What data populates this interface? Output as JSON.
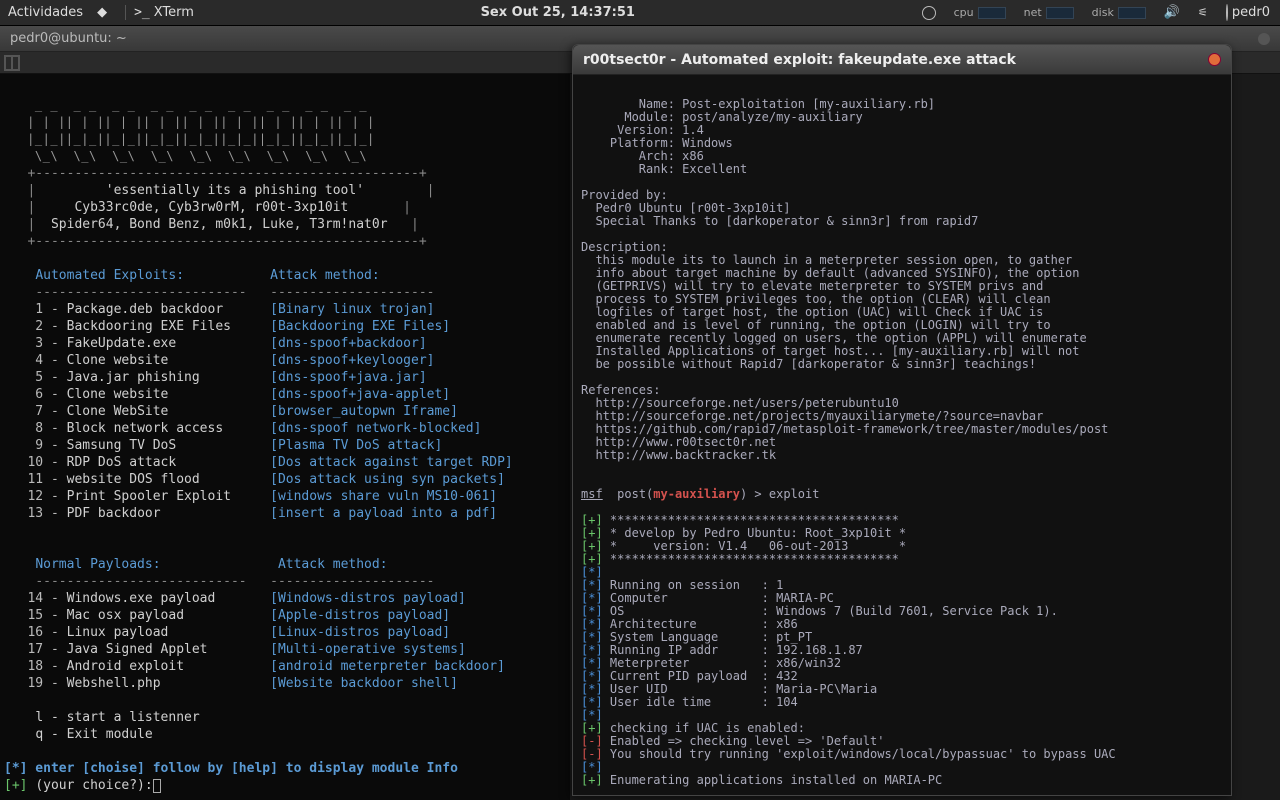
{
  "topbar": {
    "activities": "Actividades",
    "xterm": "XTerm",
    "datetime": "Sex Out 25, 14:37:51",
    "cpu": "cpu",
    "net": "net",
    "disk": "disk",
    "user": "pedr0"
  },
  "window": {
    "title": "pedr0@ubuntu: ~"
  },
  "terminal": {
    "banner_tag": "'essentially its a phishing tool'",
    "credits1": "Cyb33rc0de, Cyb3rw0rM, r00t-3xp10it",
    "credits2": "Spider64, Bond Benz, m0k1, Luke, T3rm!nat0r",
    "header_exploits": "Automated Exploits:",
    "header_method": "Attack method:",
    "exploits": [
      {
        "n": " 1",
        "name": "Package.deb backdoor",
        "method": "[Binary linux trojan]"
      },
      {
        "n": " 2",
        "name": "Backdooring EXE Files",
        "method": "[Backdooring EXE Files]"
      },
      {
        "n": " 3",
        "name": "FakeUpdate.exe",
        "method": "[dns-spoof+backdoor]"
      },
      {
        "n": " 4",
        "name": "Clone website",
        "method": "[dns-spoof+keylooger]"
      },
      {
        "n": " 5",
        "name": "Java.jar phishing",
        "method": "[dns-spoof+java.jar]"
      },
      {
        "n": " 6",
        "name": "Clone website",
        "method": "[dns-spoof+java-applet]"
      },
      {
        "n": " 7",
        "name": "Clone WebSite",
        "method": "[browser_autopwn Iframe]"
      },
      {
        "n": " 8",
        "name": "Block network access",
        "method": "[dns-spoof network-blocked]"
      },
      {
        "n": " 9",
        "name": "Samsung TV DoS",
        "method": "[Plasma TV DoS attack]"
      },
      {
        "n": "10",
        "name": "RDP DoS attack",
        "method": "[Dos attack against target RDP]"
      },
      {
        "n": "11",
        "name": "website DOS flood",
        "method": "[Dos attack using syn packets]"
      },
      {
        "n": "12",
        "name": "Print Spooler Exploit",
        "method": "[windows share vuln MS10-061]"
      },
      {
        "n": "13",
        "name": "PDF backdoor",
        "method": "[insert a payload into a pdf]"
      }
    ],
    "header_payloads": "Normal Payloads:",
    "payloads": [
      {
        "n": "14",
        "name": "Windows.exe payload",
        "method": "[Windows-distros payload]"
      },
      {
        "n": "15",
        "name": "Mac osx payload",
        "method": "[Apple-distros payload]"
      },
      {
        "n": "16",
        "name": "Linux payload",
        "method": "[Linux-distros payload]"
      },
      {
        "n": "17",
        "name": "Java Signed Applet",
        "method": "[Multi-operative systems]"
      },
      {
        "n": "18",
        "name": "Android exploit",
        "method": "[android meterpreter backdoor]"
      },
      {
        "n": "19",
        "name": "Webshell.php",
        "method": "[Website backdoor shell]"
      }
    ],
    "opt_l": "l - start a listenner",
    "opt_q": "q - Exit module",
    "hint": "[*] enter [choise] follow by [help] to display module Info",
    "prompt_prefix": "[+] ",
    "prompt": "(your choice?):"
  },
  "popup": {
    "title": "r00tsect0r - Automated exploit: fakeupdate.exe attack",
    "info": {
      "Name": "Post-exploitation [my-auxiliary.rb]",
      "Module": "post/analyze/my-auxiliary",
      "Version": "1.4",
      "Platform": "Windows",
      "Arch": "x86",
      "Rank": "Excellent"
    },
    "provided_head": "Provided by:",
    "provided": [
      "Pedr0 Ubuntu [r00t-3xp10it]",
      "Special Thanks to [darkoperator & sinn3r] from rapid7"
    ],
    "desc_head": "Description:",
    "desc": [
      "this module its to launch in a meterpreter session open, to gather",
      "info about target machine by default (advanced SYSINFO), the option",
      "(GETPRIVS) will try to elevate meterpreter to SYSTEM privs and",
      "process to SYSTEM privileges too, the option (CLEAR) will clean",
      "logfiles of target host, the option (UAC) will Check if UAC is",
      "enabled and is level of running, the option (LOGIN) will try to",
      "enumerate recently logged on users, the option (APPL) will enumerate",
      "Installed Applications of target host... [my-auxiliary.rb] will not",
      "be possible without Rapid7 [darkoperator & sinn3r] teachings!"
    ],
    "refs_head": "References:",
    "refs": [
      "http://sourceforge.net/users/peterubuntu10",
      "http://sourceforge.net/projects/myauxiliarymete/?source=navbar",
      "https://github.com/rapid7/metasploit-framework/tree/master/modules/post",
      "http://www.r00tsect0r.net",
      "http://www.backtracker.tk"
    ],
    "prompt": {
      "pre": "msf",
      "post": "post(",
      "mod": "my-auxiliary",
      "close": ") > ",
      "cmd": "exploit"
    },
    "run": [
      {
        "t": "g",
        "s": "****************************************"
      },
      {
        "t": "g",
        "s": "* develop by Pedro Ubuntu: Root_3xp10it *"
      },
      {
        "t": "g",
        "s": "*     version: V1.4   06-out-2013       *"
      },
      {
        "t": "g",
        "s": "****************************************"
      },
      {
        "t": "b",
        "s": ""
      },
      {
        "t": "b",
        "s": "Running on session   : 1"
      },
      {
        "t": "b",
        "s": "Computer             : MARIA-PC"
      },
      {
        "t": "b",
        "s": "OS                   : Windows 7 (Build 7601, Service Pack 1)."
      },
      {
        "t": "b",
        "s": "Architecture         : x86"
      },
      {
        "t": "b",
        "s": "System Language      : pt_PT"
      },
      {
        "t": "b",
        "s": "Running IP addr      : 192.168.1.87"
      },
      {
        "t": "b",
        "s": "Meterpreter          : x86/win32"
      },
      {
        "t": "b",
        "s": "Current PID payload  : 432"
      },
      {
        "t": "b",
        "s": "User UID             : Maria-PC\\Maria"
      },
      {
        "t": "b",
        "s": "User idle time       : 104"
      },
      {
        "t": "b",
        "s": ""
      },
      {
        "t": "g",
        "s": "checking if UAC is enabled:"
      },
      {
        "t": "r",
        "s": "Enabled => checking level => 'Default'"
      },
      {
        "t": "r",
        "s": "You should try running 'exploit/windows/local/bypassuac' to bypass UAC"
      },
      {
        "t": "b",
        "s": ""
      },
      {
        "t": "g",
        "s": "Enumerating applications installed on MARIA-PC"
      }
    ]
  }
}
